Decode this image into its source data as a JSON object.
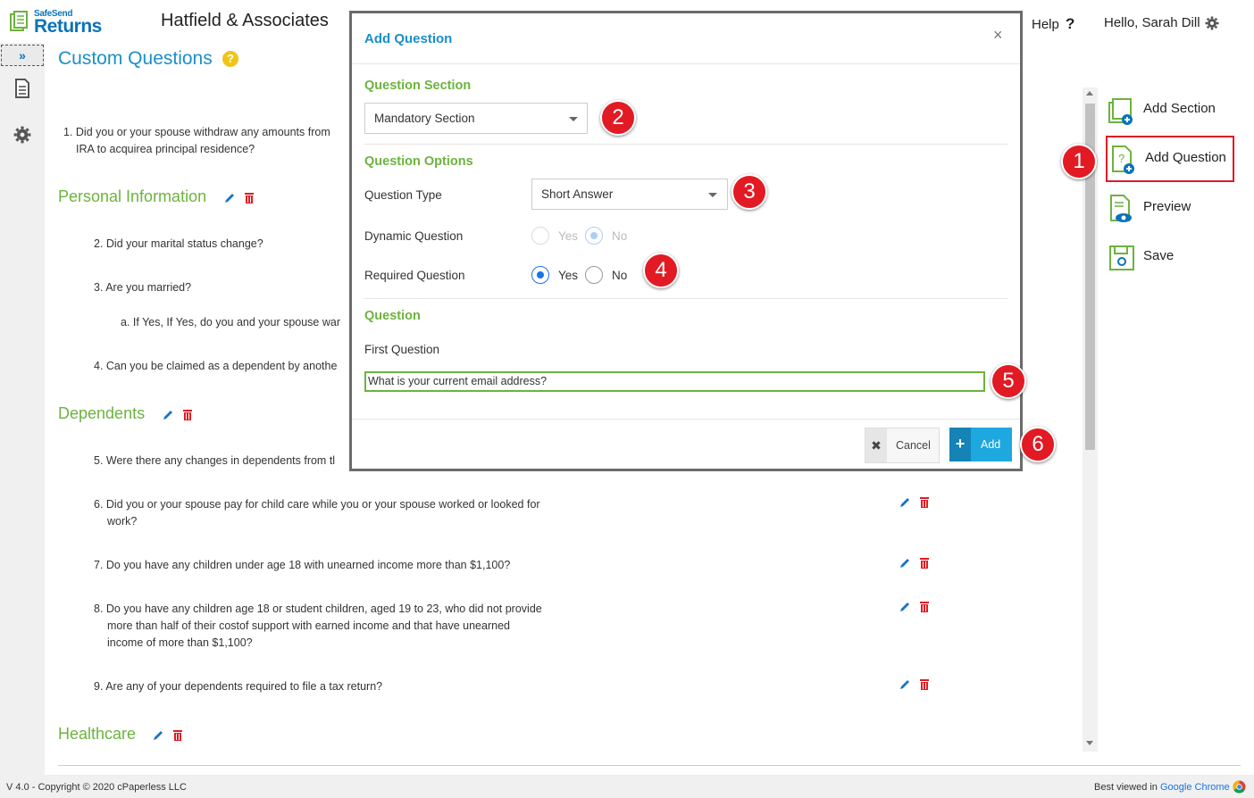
{
  "header": {
    "logo_top": "SafeSend",
    "logo_main": "Returns",
    "firm_name": "Hatfield & Associates",
    "help_label": "Help",
    "greeting": "Hello, Sarah Dill"
  },
  "page": {
    "title": "Custom Questions"
  },
  "content": {
    "q1": "1. Did you or your spouse withdraw any amounts from",
    "q1_cont": "IRA to acquirea principal residence?",
    "sections": [
      {
        "title": "Personal Information"
      },
      {
        "title": "Dependents"
      },
      {
        "title": "Healthcare"
      }
    ],
    "q2": "2. Did your marital status change?",
    "q3": "3. Are you married?",
    "q3a": "a. If Yes, If Yes, do you and your spouse war",
    "q4": "4. Can you be claimed as a dependent by anothe",
    "q5": "5. Were there any changes in dependents from tl",
    "q6": "6. Did you or your spouse pay for child care while you or your spouse worked or looked for",
    "q6_cont": "work?",
    "q7": "7. Do you have any children under age 18 with unearned income more than $1,100?",
    "q8": "8. Do you have any children age 18 or student children, aged 19 to 23, who did not provide",
    "q8_cont1": "more than half of their costof support with earned income and that have unearned",
    "q8_cont2": "income of more than $1,100?",
    "q9": "9. Are any of your dependents required to file a tax return?"
  },
  "right_menu": [
    {
      "label": "Add Section",
      "icon": "add-section-icon"
    },
    {
      "label": "Add Question",
      "icon": "add-question-icon"
    },
    {
      "label": "Preview",
      "icon": "preview-icon"
    },
    {
      "label": "Save",
      "icon": "save-icon"
    }
  ],
  "modal": {
    "title": "Add Question",
    "close": "×",
    "section_heading": "Question Section",
    "section_value": "Mandatory Section",
    "options_heading": "Question Options",
    "question_type_label": "Question Type",
    "question_type_value": "Short Answer",
    "dynamic_label": "Dynamic Question",
    "required_label": "Required Question",
    "yes": "Yes",
    "no": "No",
    "question_heading": "Question",
    "first_question_label": "First Question",
    "first_question_value": "What is your current email address?",
    "cancel": "Cancel",
    "add": "Add"
  },
  "callouts": [
    "1",
    "2",
    "3",
    "4",
    "5",
    "6"
  ],
  "footer": {
    "version": "V 4.0 - Copyright © 2020 cPaperless LLC",
    "best_viewed": "Best viewed in ",
    "browser": "Google Chrome"
  },
  "colors": {
    "accent_blue": "#1a8fc9",
    "section_green": "#6cb33e",
    "callout_red": "#e21a23",
    "add_button": "#1ea8e0"
  }
}
